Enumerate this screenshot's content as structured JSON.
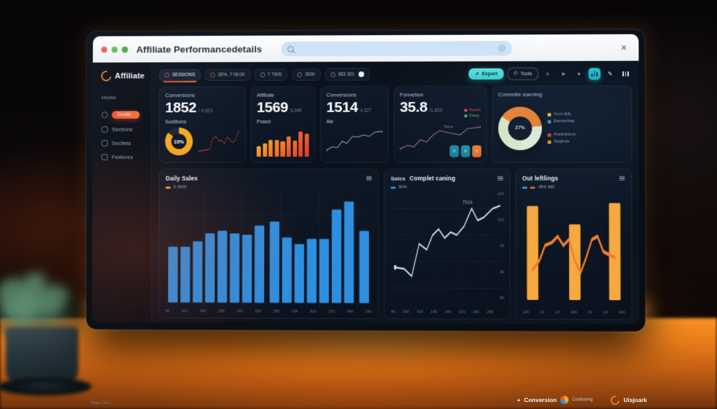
{
  "browser": {
    "title": "Affiliate Performancedetails",
    "search_placeholder": "",
    "close_label": "×",
    "traffic_lights": [
      "close",
      "minimize",
      "maximize"
    ]
  },
  "sidebar": {
    "brand": "Affiliate",
    "section_label": "Home",
    "items": [
      {
        "label": "Goals",
        "icon": "circle-icon",
        "active": true
      },
      {
        "label": "Sections",
        "icon": "bag-icon",
        "active": false
      },
      {
        "label": "Sectlets",
        "icon": "image-icon",
        "active": false
      },
      {
        "label": "Features",
        "icon": "tag-icon",
        "active": false
      }
    ]
  },
  "toolbar": {
    "chips": [
      {
        "label": "SESSIONS",
        "icon": "target-icon",
        "active": true
      },
      {
        "label": "30%, 7 06:00",
        "icon": "flag-icon",
        "active": false
      },
      {
        "label": "7 790S",
        "icon": "share-icon",
        "active": false
      },
      {
        "label": "3000",
        "icon": "trend-icon",
        "active": false
      },
      {
        "label": "983 301",
        "icon": "globe-icon",
        "active": false,
        "badge": true
      }
    ],
    "export_label": "Export",
    "export_icon": "upload-icon",
    "secondary_label": "Tools",
    "secondary_icon": "copy-icon",
    "icon_buttons": [
      {
        "name": "filter-icon",
        "glyph": "≡",
        "selected": false
      },
      {
        "name": "cursor-icon",
        "glyph": "➤",
        "selected": false
      },
      {
        "name": "chevron-down-icon",
        "glyph": "▾",
        "selected": false
      },
      {
        "name": "bar-chart-icon",
        "glyph": "bars",
        "selected": true
      },
      {
        "name": "edit-icon",
        "glyph": "✒",
        "selected": false
      },
      {
        "name": "columns-icon",
        "glyph": "bars",
        "selected": false
      }
    ]
  },
  "kpis": [
    {
      "title": "Conversions",
      "value": "1852",
      "delta": "/ 4,923"
    },
    {
      "title": "Affiliate",
      "value": "1569",
      "delta": "6,345"
    },
    {
      "title": "Conversions",
      "value": "1514",
      "delta": "4,327"
    },
    {
      "title": "Fonvetion",
      "value": "35.8",
      "delta": "/1.833",
      "tag_up": "Reach",
      "tag_down": "Dawg"
    }
  ],
  "kpi_widgets": {
    "donut_title": "Suctibons",
    "donut_pct": "10%",
    "bars_title": "Posed",
    "line_title": "Ale",
    "line_annotation": "Tiernoo",
    "pills": [
      "0",
      "0",
      "0"
    ]
  },
  "donut_panel": {
    "title": "Commite earning",
    "center_label": "27%",
    "legend": [
      {
        "label": "Com &ify",
        "color": "#f0c020"
      },
      {
        "label": "Earderthas",
        "color": "#3f8fd8"
      },
      {
        "label": "Publ/rtrdms",
        "color": "#e8452b"
      },
      {
        "label": "Suglmts",
        "color": "#f09a22"
      }
    ]
  },
  "panels": {
    "bars": {
      "title": "Daily Sales",
      "legend": "S 3000",
      "legend_color": "#f0a524",
      "menu_icon": "kebab-icon"
    },
    "line": {
      "tab": "Sales",
      "title": "Complet caning",
      "legend": "30%",
      "legend_color": "#3f8fd8",
      "annotation": "Phorin",
      "menu_icon": "kebab-icon"
    },
    "combo": {
      "title": "Out leftlings",
      "legend": "-856 300",
      "legend_color_a": "#3f8fd8",
      "legend_color_b": "#e8572b",
      "menu_icon": "kebab-icon"
    }
  },
  "footer": {
    "left_note": "Now 114...",
    "conversion_label": "Conversion",
    "conversion_sub": "Combaring",
    "brand": "Uisjoark",
    "plus_icon": "plus-icon"
  },
  "chart_data": [
    {
      "type": "bar",
      "title": "Daily Sales",
      "categories": [
        "40",
        "101",
        "240",
        "208",
        "240",
        "260",
        "280",
        "294",
        "810",
        "220",
        "340",
        "240"
      ],
      "values": [
        52,
        52,
        57,
        64,
        67,
        65,
        64,
        72,
        74,
        62,
        58,
        63,
        63,
        80,
        92,
        70
      ],
      "ylim": [
        0,
        100
      ],
      "xlabel": "",
      "ylabel": "",
      "series_color": "#2e8fe0",
      "grid": true,
      "legend": "S 3000"
    },
    {
      "type": "line",
      "title": "Complet caning",
      "x": [
        "40",
        "240",
        "500",
        "140",
        "140",
        "220",
        "240",
        "256"
      ],
      "values": [
        42,
        40,
        33,
        62,
        58,
        70,
        74,
        66,
        70,
        68,
        78,
        96,
        84,
        88,
        100,
        108
      ],
      "ytick_labels": [
        "140",
        "110",
        "70",
        "30",
        "50"
      ],
      "ylim": [
        0,
        140
      ],
      "legend": "30%",
      "annotation": "Phorin",
      "series_color": "#c8d6e6",
      "grid": true
    },
    {
      "type": "bar",
      "title": "Out leftlings",
      "categories": [
        "140",
        "21",
        "14",
        "240",
        "41",
        "24",
        "240"
      ],
      "bar_values": [
        96,
        0,
        0,
        62,
        0,
        0,
        100
      ],
      "line_values": [
        28,
        36,
        52,
        50,
        58,
        46,
        52,
        34,
        30,
        46,
        58,
        56,
        40
      ],
      "ylim": [
        0,
        100
      ],
      "bar_color": "#f6a councils",
      "series_color": "#f0832c",
      "grid": false,
      "legend": "-856 300"
    }
  ]
}
